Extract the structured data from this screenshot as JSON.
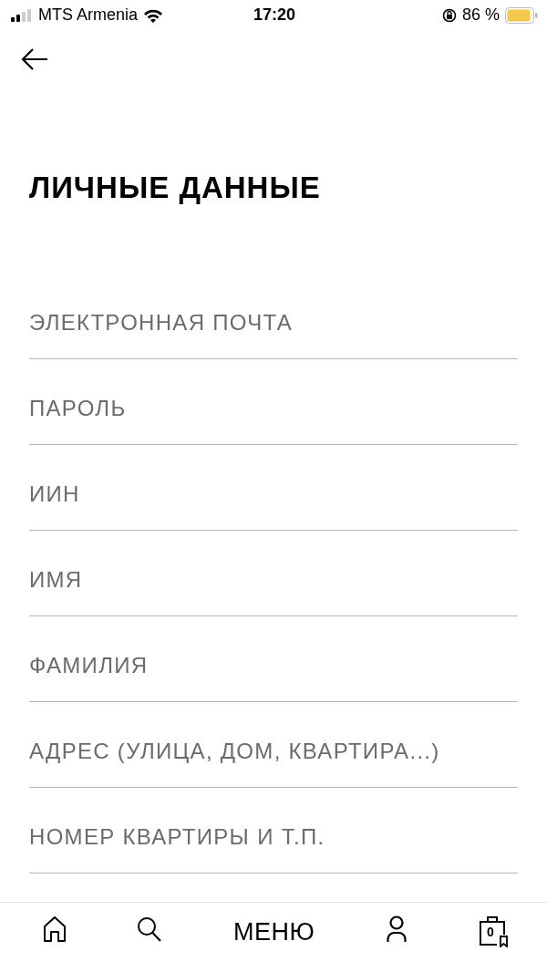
{
  "status_bar": {
    "carrier": "MTS Armenia",
    "time": "17:20",
    "battery": "86 %"
  },
  "title": "ЛИЧНЫЕ ДАННЫЕ",
  "fields": [
    {
      "placeholder": "ЭЛЕКТРОННАЯ ПОЧТА"
    },
    {
      "placeholder": "ПАРОЛЬ"
    },
    {
      "placeholder": "ИИН"
    },
    {
      "placeholder": "ИМЯ"
    },
    {
      "placeholder": "ФАМИЛИЯ"
    },
    {
      "placeholder": "АДРЕС (УЛИЦА, ДОМ, КВАРТИРА...)"
    },
    {
      "placeholder": "НОМЕР КВАРТИРЫ И Т.П."
    }
  ],
  "bottom_nav": {
    "menu": "МЕНЮ",
    "cart_count": "0"
  }
}
